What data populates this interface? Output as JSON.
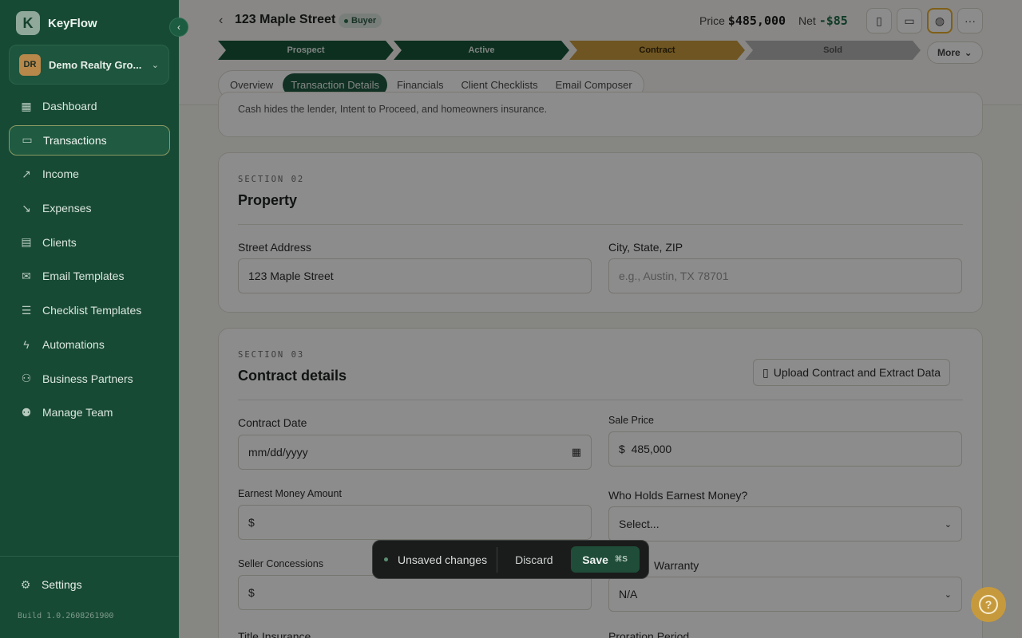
{
  "app": {
    "name": "KeyFlow",
    "logo_letter": "K",
    "collapse_icon": "chevron-left-icon"
  },
  "org": {
    "initials": "DR",
    "name": "Demo Realty Gro..."
  },
  "sidebar": {
    "items": [
      {
        "label": "Dashboard",
        "icon": "grid-icon",
        "glyph": "▦"
      },
      {
        "label": "Transactions",
        "icon": "briefcase-icon",
        "glyph": "▭",
        "active": true
      },
      {
        "label": "Income",
        "icon": "trending-up-icon",
        "glyph": "↗"
      },
      {
        "label": "Expenses",
        "icon": "trending-down-icon",
        "glyph": "↘"
      },
      {
        "label": "Clients",
        "icon": "contacts-icon",
        "glyph": "▤"
      },
      {
        "label": "Email Templates",
        "icon": "mail-icon",
        "glyph": "✉"
      },
      {
        "label": "Checklist Templates",
        "icon": "checklist-icon",
        "glyph": "☰"
      },
      {
        "label": "Automations",
        "icon": "lightning-icon",
        "glyph": "ϟ"
      },
      {
        "label": "Business Partners",
        "icon": "users-icon",
        "glyph": "⚇"
      },
      {
        "label": "Manage Team",
        "icon": "team-icon",
        "glyph": "⚉"
      }
    ],
    "settings": "Settings",
    "build": "Build 1.0.2608261900"
  },
  "header": {
    "title": "123 Maple Street",
    "badge": "Buyer",
    "price_label": "Price",
    "price_value": "$485,000",
    "net_label": "Net",
    "net_value": "-$85"
  },
  "pipeline": {
    "stages": [
      "Prospect",
      "Active",
      "Contract",
      "Sold"
    ],
    "more": "More"
  },
  "tabs": [
    "Overview",
    "Transaction Details",
    "Financials",
    "Client Checklists",
    "Email Composer"
  ],
  "section1": {
    "note": "Cash hides the lender, Intent to Proceed, and homeowners insurance."
  },
  "section2": {
    "kicker": "SECTION 02",
    "title": "Property",
    "street_label": "Street Address",
    "street_value": "123 Maple Street",
    "city_label": "City, State, ZIP",
    "city_placeholder": "e.g., Austin, TX 78701"
  },
  "section3": {
    "kicker": "SECTION 03",
    "title": "Contract details",
    "upload": "Upload Contract and Extract Data",
    "contract_date_label": "Contract Date",
    "contract_date_value": "mm/dd/yyyy",
    "sale_price_label": "Sale Price",
    "sale_price_prefix": "$",
    "sale_price_value": "485,000",
    "earnest_label": "Earnest Money Amount",
    "earnest_prefix": "$",
    "holder_label": "Who Holds Earnest Money?",
    "holder_value": "Select...",
    "concessions_label": "Seller Concessions",
    "concessions_prefix": "$",
    "warranty_label": "Warranty",
    "warranty_value": "N/A",
    "title_label": "Title Insurance",
    "proration_label": "Proration Period"
  },
  "savebar": {
    "status": "Unsaved changes",
    "discard": "Discard",
    "save": "Save",
    "shortcut": "⌘S"
  },
  "colors": {
    "sidebar": "#174a35",
    "accent": "#1e5a40",
    "contract_stage": "#c99b3f",
    "help": "#c69a3c"
  }
}
